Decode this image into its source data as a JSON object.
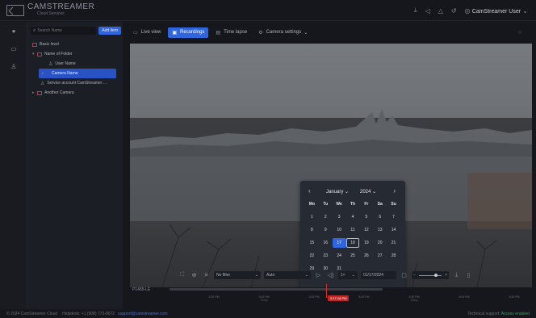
{
  "app": {
    "title": "CAMSTREAMER",
    "subtitle": "Cloud Services"
  },
  "topbar": {
    "icons": [
      "download-icon",
      "megaphone-icon",
      "alert-icon",
      "history-icon",
      "user-icon"
    ],
    "user_label": "CamStreamer User"
  },
  "sidebar": {
    "search_placeholder": "Search Name",
    "add_label": "Add item",
    "items": [
      {
        "label": "Basic level",
        "level": 0,
        "type": "folder"
      },
      {
        "label": "Name of Folder",
        "level": 1,
        "type": "folder"
      },
      {
        "label": "User Name",
        "level": 2,
        "type": "user"
      },
      {
        "label": "Camera Name",
        "level": 2,
        "type": "camera",
        "selected": true
      },
      {
        "label": "Service account CamStreamer ...",
        "level": 1,
        "type": "user"
      },
      {
        "label": "Another Camera",
        "level": 1,
        "type": "camera"
      }
    ]
  },
  "tabs": [
    {
      "label": "Live view",
      "icon": "camera-icon",
      "active": false
    },
    {
      "label": "Recordings",
      "icon": "recordings-icon",
      "active": true
    },
    {
      "label": "Time lapse",
      "icon": "timelapse-icon",
      "active": false
    },
    {
      "label": "Camera settings",
      "icon": "gear-icon",
      "active": false
    }
  ],
  "calendar": {
    "month": "January",
    "year": "2024",
    "weekdays": [
      "Mo",
      "Tu",
      "We",
      "Th",
      "Fr",
      "Sa",
      "Su"
    ],
    "days": [
      "",
      "",
      "",
      "",
      "",
      "",
      "",
      "1",
      "2",
      "3",
      "4",
      "5",
      "6",
      "7",
      "8",
      "9",
      "10",
      "11",
      "12",
      "13",
      "14",
      "15",
      "16",
      "17",
      "18",
      "19",
      "20",
      "21",
      "22",
      "23",
      "24",
      "25",
      "26",
      "27",
      "28",
      "29",
      "30",
      "31"
    ],
    "today": "17",
    "selected": "18"
  },
  "controls": {
    "filter": "No filter",
    "quality": "Auto",
    "speed": "1×",
    "date": "01/17/2024",
    "minus": "−",
    "plus": "+"
  },
  "timeline": {
    "camera": "P1465-LE",
    "ticks": [
      {
        "time": "2:30 PM",
        "sub": ""
      },
      {
        "time": "3:00 PM",
        "sub": "Today"
      },
      {
        "time": "3:30 PM",
        "sub": ""
      },
      {
        "time": "4:00 PM",
        "sub": ""
      },
      {
        "time": "4:30 PM",
        "sub": "Today"
      },
      {
        "time": "5:00 PM",
        "sub": ""
      },
      {
        "time": "5:30 PM",
        "sub": ""
      }
    ],
    "cursor_time": "3:17:18 PM"
  },
  "footer": {
    "copyright": "© 2024 CamStreamer Cloud",
    "helpdesk": "Helpdesk: +1 (908) 773-8672",
    "email": "support@camstreamer.com",
    "support_label": "Technical support:",
    "support_status": "Access enabled"
  }
}
